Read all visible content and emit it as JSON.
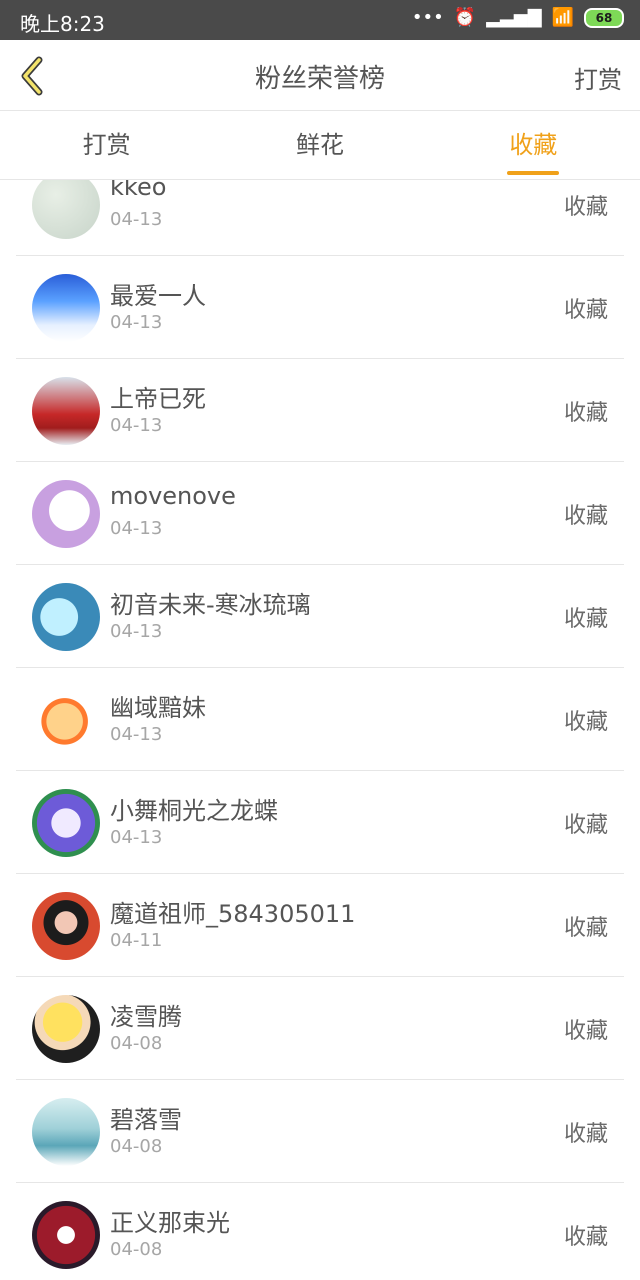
{
  "status_bar": {
    "time": "晚上8:23",
    "dots": "•••",
    "alarm_icon": "⏰",
    "signal_icon": "▂▃▅▇",
    "wifi_icon": "📶",
    "battery": "68"
  },
  "header": {
    "back_icon": "chevron-left",
    "title": "粉丝荣誉榜",
    "action": "打赏"
  },
  "tabs": [
    {
      "label": "打赏"
    },
    {
      "label": "鲜花"
    },
    {
      "label": "收藏"
    }
  ],
  "list": {
    "items": [
      {
        "name": "kkeo",
        "date": "04-13",
        "action": "收藏"
      },
      {
        "name": "最爱一人",
        "date": "04-13",
        "action": "收藏"
      },
      {
        "name": "上帝已死",
        "date": "04-13",
        "action": "收藏"
      },
      {
        "name": "movenove",
        "date": "04-13",
        "action": "收藏"
      },
      {
        "name": "初音未来-寒冰琉璃",
        "date": "04-13",
        "action": "收藏"
      },
      {
        "name": "幽域黯妹",
        "date": "04-13",
        "action": "收藏"
      },
      {
        "name": "小舞桐光之龙蝶",
        "date": "04-13",
        "action": "收藏"
      },
      {
        "name": "魔道祖师_584305011",
        "date": "04-11",
        "action": "收藏"
      },
      {
        "name": "凌雪腾",
        "date": "04-08",
        "action": "收藏"
      },
      {
        "name": "碧落雪",
        "date": "04-08",
        "action": "收藏"
      },
      {
        "name": "正义那束光",
        "date": "04-08",
        "action": "收藏"
      }
    ]
  }
}
